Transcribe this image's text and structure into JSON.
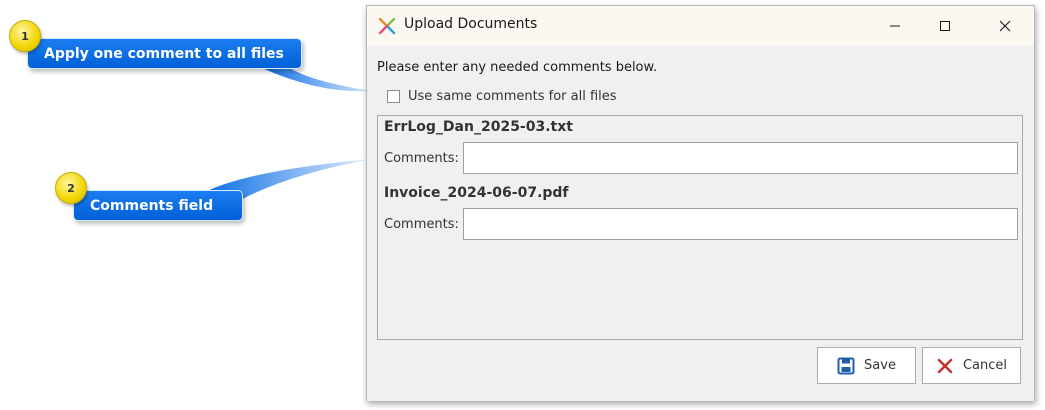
{
  "window": {
    "title": "Upload Documents",
    "icon": "x-logo-icon"
  },
  "dialog": {
    "instructions": "Please enter any needed comments below.",
    "same_comments_label": "Use same comments for all files",
    "same_comments_checked": false,
    "files": [
      {
        "name": "ErrLog_Dan_2025-03.txt",
        "comment_label": "Comments:",
        "comment_value": ""
      },
      {
        "name": "Invoice_2024-06-07.pdf",
        "comment_label": "Comments:",
        "comment_value": ""
      }
    ],
    "save_label": "Save",
    "cancel_label": "Cancel"
  },
  "callouts": [
    {
      "number": "1",
      "text": "Apply one comment to all files"
    },
    {
      "number": "2",
      "text": "Comments field"
    }
  ],
  "colors": {
    "callout_blue": "#0a6ee6",
    "badge_yellow": "#f0d500",
    "save_icon": "#1f5fa8",
    "cancel_icon": "#c4302b",
    "logo_orange": "#f08a24",
    "logo_blue": "#2a9fd8"
  }
}
